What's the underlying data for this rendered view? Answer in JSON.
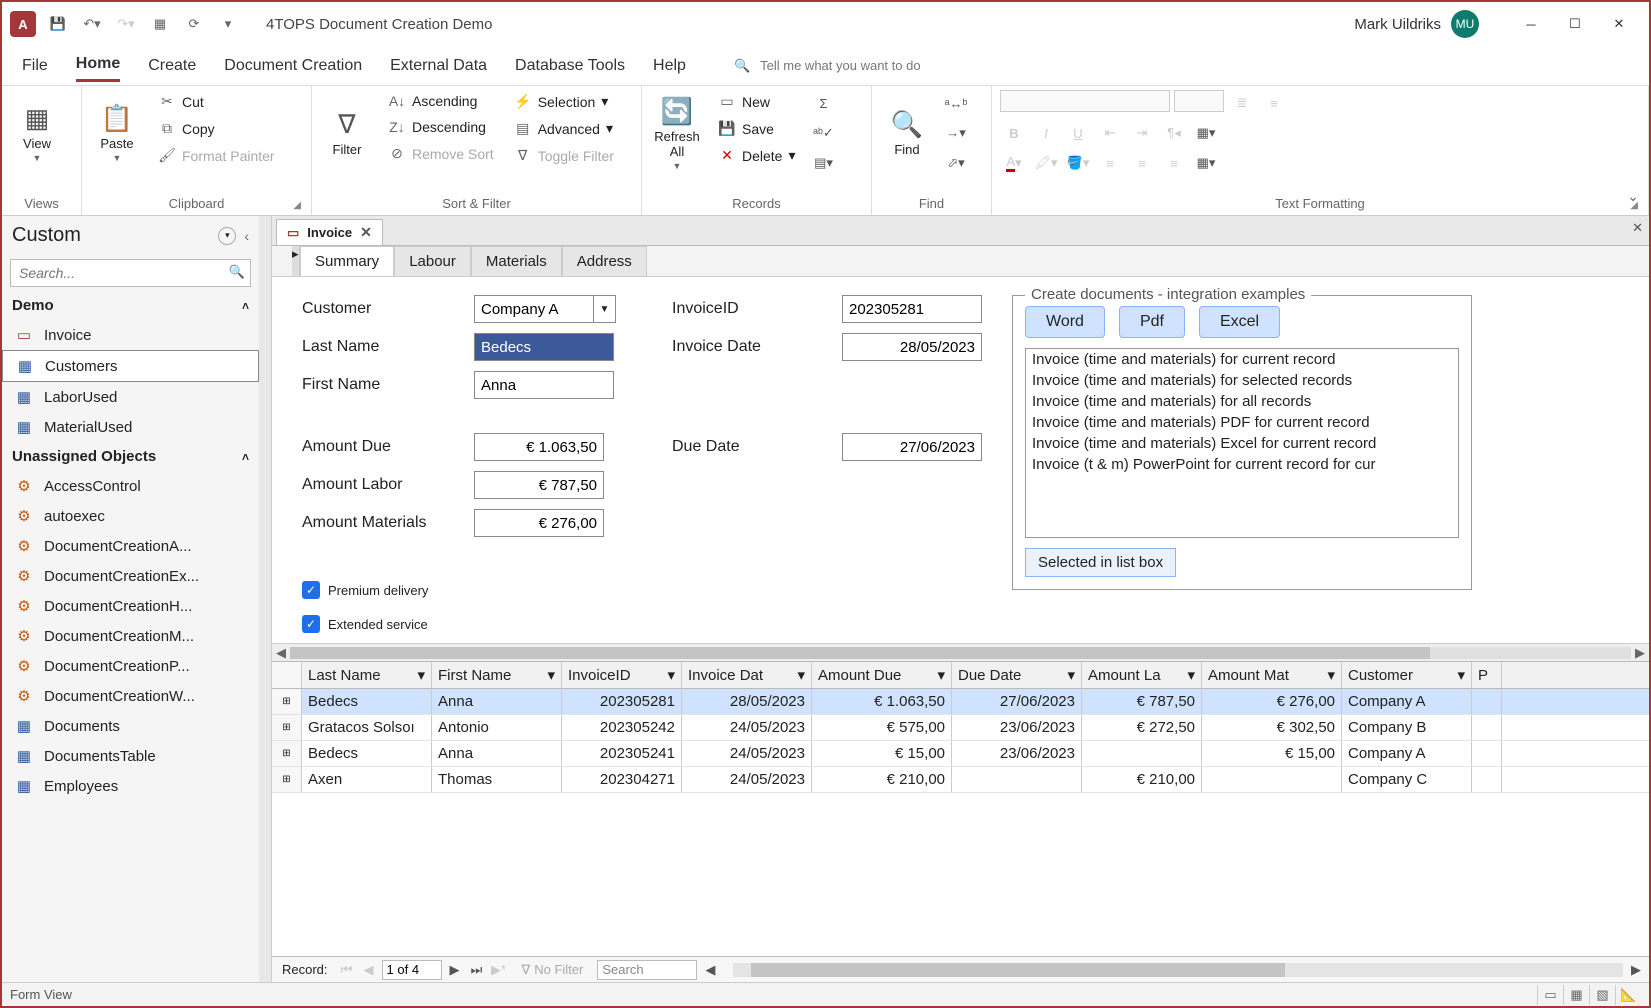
{
  "title": "4TOPS Document Creation Demo",
  "user": {
    "name": "Mark Uildriks",
    "initials": "MU"
  },
  "menu": {
    "items": [
      "File",
      "Home",
      "Create",
      "Document Creation",
      "External Data",
      "Database Tools",
      "Help"
    ],
    "active": "Home",
    "tellme": "Tell me what you want to do"
  },
  "ribbon": {
    "views": {
      "label": "Views",
      "btn": "View"
    },
    "clipboard": {
      "label": "Clipboard",
      "paste": "Paste",
      "cut": "Cut",
      "copy": "Copy",
      "fmt": "Format Painter"
    },
    "sortfilter": {
      "label": "Sort & Filter",
      "filter": "Filter",
      "asc": "Ascending",
      "desc": "Descending",
      "remove": "Remove Sort",
      "selection": "Selection",
      "advanced": "Advanced",
      "toggle": "Toggle Filter"
    },
    "records": {
      "label": "Records",
      "refresh": "Refresh\nAll",
      "new": "New",
      "save": "Save",
      "delete": "Delete"
    },
    "find": {
      "label": "Find",
      "find": "Find"
    },
    "textfmt": {
      "label": "Text Formatting"
    }
  },
  "nav": {
    "title": "Custom",
    "search_placeholder": "Search...",
    "groups": [
      {
        "name": "Demo",
        "items": [
          {
            "label": "Invoice",
            "type": "form"
          },
          {
            "label": "Customers",
            "type": "table",
            "selected": true
          },
          {
            "label": "LaborUsed",
            "type": "table"
          },
          {
            "label": "MaterialUsed",
            "type": "table"
          }
        ]
      },
      {
        "name": "Unassigned Objects",
        "items": [
          {
            "label": "AccessControl",
            "type": "macro"
          },
          {
            "label": "autoexec",
            "type": "macro"
          },
          {
            "label": "DocumentCreationA...",
            "type": "macro"
          },
          {
            "label": "DocumentCreationEx...",
            "type": "macro"
          },
          {
            "label": "DocumentCreationH...",
            "type": "macro"
          },
          {
            "label": "DocumentCreationM...",
            "type": "macro"
          },
          {
            "label": "DocumentCreationP...",
            "type": "macro"
          },
          {
            "label": "DocumentCreationW...",
            "type": "macro"
          },
          {
            "label": "Documents",
            "type": "table"
          },
          {
            "label": "DocumentsTable",
            "type": "table"
          },
          {
            "label": "Employees",
            "type": "table"
          }
        ]
      }
    ]
  },
  "doc": {
    "tab": "Invoice",
    "form_tabs": [
      "Summary",
      "Labour",
      "Materials",
      "Address"
    ],
    "active_form_tab": "Summary",
    "fields": {
      "customer_lbl": "Customer",
      "customer_val": "Company A",
      "lastname_lbl": "Last Name",
      "lastname_val": "Bedecs",
      "firstname_lbl": "First Name",
      "firstname_val": "Anna",
      "amountdue_lbl": "Amount Due",
      "amountdue_val": "€ 1.063,50",
      "amountlabor_lbl": "Amount Labor",
      "amountlabor_val": "€ 787,50",
      "amountmat_lbl": "Amount Materials",
      "amountmat_val": "€ 276,00",
      "invoiceid_lbl": "InvoiceID",
      "invoiceid_val": "202305281",
      "invoicedate_lbl": "Invoice Date",
      "invoicedate_val": "28/05/2023",
      "duedate_lbl": "Due Date",
      "duedate_val": "27/06/2023",
      "premium_lbl": "Premium delivery",
      "extended_lbl": "Extended service"
    },
    "docgroup": {
      "legend": "Create documents - integration examples",
      "buttons": {
        "word": "Word",
        "pdf": "Pdf",
        "excel": "Excel"
      },
      "list": [
        "Invoice (time and materials) for current record",
        "Invoice (time and materials) for selected records",
        "Invoice (time and materials) for all records",
        "Invoice (time and materials) PDF for current record",
        "Invoice (time and materials) Excel for current record",
        "Invoice (t & m) PowerPoint for current record for cur"
      ],
      "selbtn": "Selected in list box"
    }
  },
  "grid": {
    "headers": [
      "Last Name",
      "First Name",
      "InvoiceID",
      "Invoice Dat",
      "Amount Due",
      "Due Date",
      "Amount La",
      "Amount Mat",
      "Customer",
      "P"
    ],
    "rows": [
      {
        "ln": "Bedecs",
        "fn": "Anna",
        "id": "202305281",
        "dt": "28/05/2023",
        "ad": "€ 1.063,50",
        "dd": "27/06/2023",
        "al": "€ 787,50",
        "am": "€ 276,00",
        "cu": "Company A",
        "sel": true
      },
      {
        "ln": "Gratacos Solsoı",
        "fn": "Antonio",
        "id": "202305242",
        "dt": "24/05/2023",
        "ad": "€ 575,00",
        "dd": "23/06/2023",
        "al": "€ 272,50",
        "am": "€ 302,50",
        "cu": "Company B"
      },
      {
        "ln": "Bedecs",
        "fn": "Anna",
        "id": "202305241",
        "dt": "24/05/2023",
        "ad": "€ 15,00",
        "dd": "23/06/2023",
        "al": "",
        "am": "€ 15,00",
        "cu": "Company A"
      },
      {
        "ln": "Axen",
        "fn": "Thomas",
        "id": "202304271",
        "dt": "24/05/2023",
        "ad": "€ 210,00",
        "dd": "",
        "al": "€ 210,00",
        "am": "",
        "cu": "Company C"
      }
    ]
  },
  "recnav": {
    "label": "Record:",
    "pos": "1 of 4",
    "filter": "No Filter",
    "search": "Search"
  },
  "status": {
    "text": "Form View"
  }
}
